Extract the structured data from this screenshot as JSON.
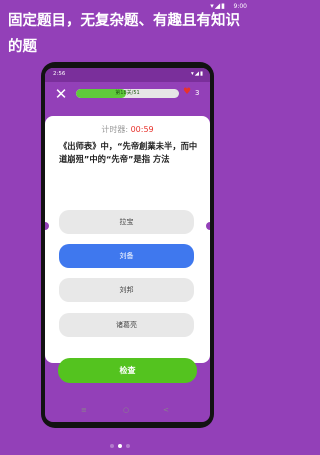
{
  "outer_status": {
    "time": "9:00",
    "icons": "▾◢▮"
  },
  "headline": "固定题目，无复杂题、有趣且有知识的题",
  "inner_status": {
    "time": "2:56",
    "right": "▾◢▮"
  },
  "progress": {
    "label": "第18关/51",
    "value": 0.49
  },
  "lives": {
    "count": "3"
  },
  "timer": {
    "label": "计时器:",
    "value": "00:59"
  },
  "question": "《出师表》中，“先帝創業未半，而中道崩殂”中的“先帝”是指 方法",
  "options": [
    {
      "label": "拉宝",
      "selected": false
    },
    {
      "label": "刘备",
      "selected": true
    },
    {
      "label": "刘邦",
      "selected": false
    },
    {
      "label": "诸葛亮",
      "selected": false
    }
  ],
  "check_button": "检查",
  "navbar": {
    "menu": "≡",
    "home": "○",
    "back": "<"
  },
  "page_dots": 3,
  "colors": {
    "background": "#9340b8",
    "selected": "#3f78ee",
    "check": "#54c31f",
    "timer": "#e8322c"
  }
}
